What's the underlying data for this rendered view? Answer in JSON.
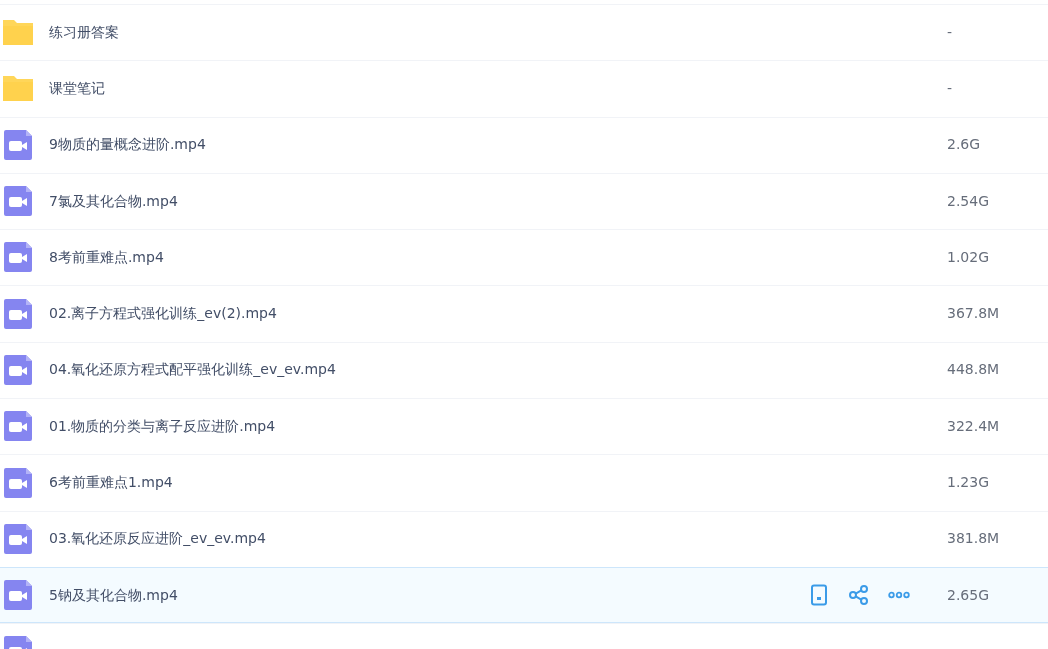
{
  "files": [
    {
      "kind": "folder",
      "name": "练习册答案",
      "size": "-",
      "hovered": false
    },
    {
      "kind": "folder",
      "name": "课堂笔记",
      "size": "-",
      "hovered": false
    },
    {
      "kind": "video",
      "name": "9物质的量概念进阶.mp4",
      "size": "2.6G",
      "hovered": false
    },
    {
      "kind": "video",
      "name": "7氯及其化合物.mp4",
      "size": "2.54G",
      "hovered": false
    },
    {
      "kind": "video",
      "name": "8考前重难点.mp4",
      "size": "1.02G",
      "hovered": false
    },
    {
      "kind": "video",
      "name": "02.离子方程式强化训练_ev(2).mp4",
      "size": "367.8M",
      "hovered": false
    },
    {
      "kind": "video",
      "name": "04.氧化还原方程式配平强化训练_ev_ev.mp4",
      "size": "448.8M",
      "hovered": false
    },
    {
      "kind": "video",
      "name": "01.物质的分类与离子反应进阶.mp4",
      "size": "322.4M",
      "hovered": false
    },
    {
      "kind": "video",
      "name": "6考前重难点1.mp4",
      "size": "1.23G",
      "hovered": false
    },
    {
      "kind": "video",
      "name": "03.氧化还原反应进阶_ev_ev.mp4",
      "size": "381.8M",
      "hovered": false
    },
    {
      "kind": "video",
      "name": "5钠及其化合物.mp4",
      "size": "2.65G",
      "hovered": true
    },
    {
      "kind": "video",
      "hovered": false
    }
  ]
}
